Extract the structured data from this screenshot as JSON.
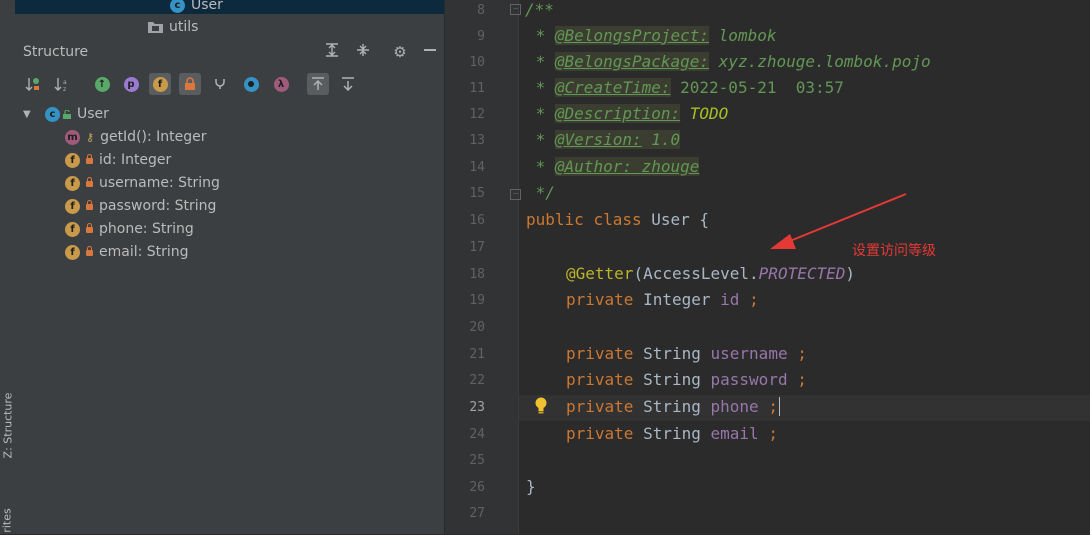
{
  "project_tree": {
    "selected_file": "User",
    "folder": "utils"
  },
  "structure_panel": {
    "title": "Structure",
    "root": {
      "name": "User"
    },
    "members": [
      {
        "text": "getId(): Integer",
        "kind": "method",
        "badge": "m"
      },
      {
        "text": "id: Integer",
        "kind": "field",
        "badge": "f"
      },
      {
        "text": "username: String",
        "kind": "field",
        "badge": "f"
      },
      {
        "text": "password: String",
        "kind": "field",
        "badge": "f"
      },
      {
        "text": "phone: String",
        "kind": "field",
        "badge": "f"
      },
      {
        "text": "email: String",
        "kind": "field",
        "badge": "f"
      }
    ]
  },
  "toolbar_badges": {
    "p": "p",
    "f": "f",
    "lambda": "λ"
  },
  "side_tabs": {
    "structure": "Z: Structure",
    "favorites": "rites"
  },
  "editor": {
    "line_numbers": [
      "8",
      "9",
      "10",
      "11",
      "12",
      "13",
      "14",
      "15",
      "16",
      "17",
      "18",
      "19",
      "20",
      "21",
      "22",
      "23",
      "24",
      "25",
      "26",
      "27"
    ],
    "current_line": "23",
    "doc": {
      "open": "/**",
      "project_tag": "@BelongsProject:",
      "project_val": "lombok",
      "package_tag": "@BelongsPackage:",
      "package_val": "xyz.zhouge.lombok.pojo",
      "created_tag": "@CreateTime:",
      "created_val": "2022-05-21  03:57",
      "desc_tag": "@Description:",
      "desc_val": "TODO",
      "version_tag": "@Version:",
      "version_val": "1.0",
      "author_tag": "@Author: zhouge",
      "close": " */"
    },
    "class_decl": {
      "kw1": "public",
      "kw2": "class",
      "name": "User",
      "brace": "{"
    },
    "getter": {
      "annotation": "@Getter",
      "arg_class": "AccessLevel.",
      "arg_const": "PROTECTED"
    },
    "fields": [
      {
        "mod": "private",
        "type": "Integer",
        "name": "id"
      },
      {
        "mod": "private",
        "type": "String",
        "name": "username"
      },
      {
        "mod": "private",
        "type": "String",
        "name": "password"
      },
      {
        "mod": "private",
        "type": "String",
        "name": "phone"
      },
      {
        "mod": "private",
        "type": "String",
        "name": "email"
      }
    ],
    "closing_brace": "}"
  },
  "annotation_note": {
    "text": "设置访问等级",
    "color": "#e53935"
  },
  "colors": {
    "class_badge": "#3592c4",
    "field_badge": "#c99a4a",
    "method_badge": "#a05b7c",
    "selection": "#0d293e"
  }
}
